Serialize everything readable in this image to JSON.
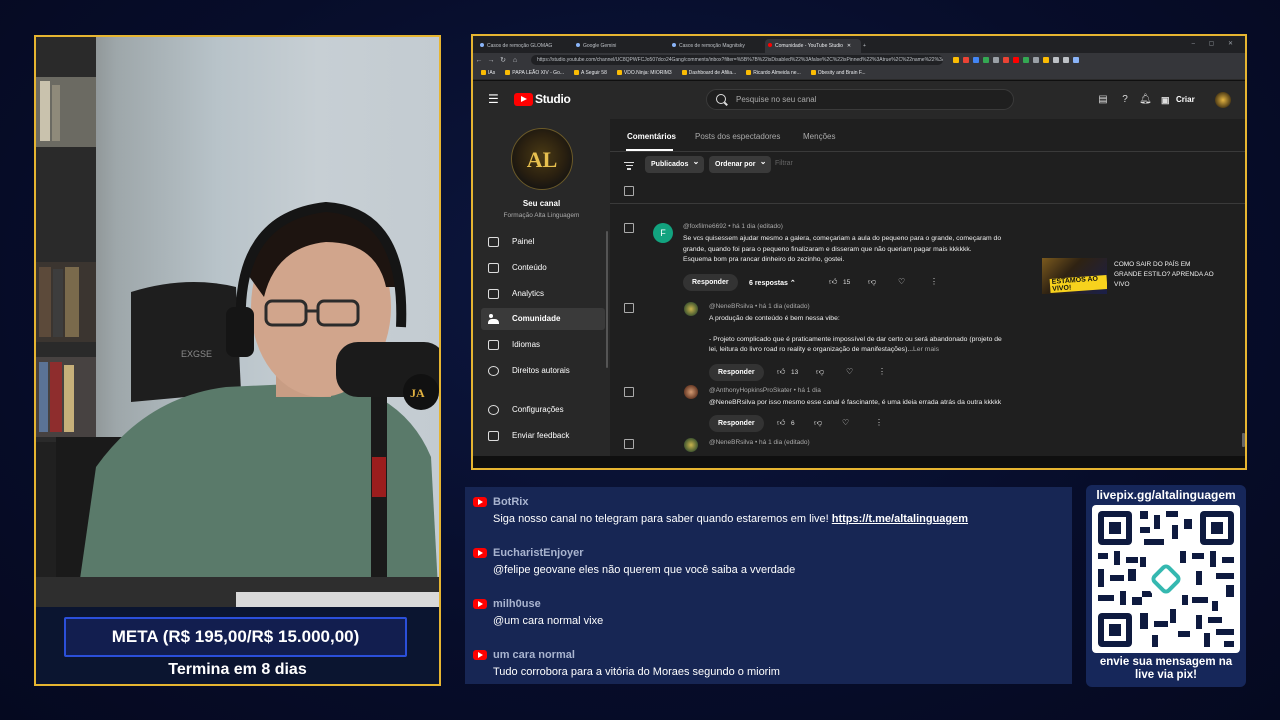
{
  "browser": {
    "tabs": [
      {
        "label": "Casos de remoção GLOMAG",
        "active": false
      },
      {
        "label": "Google Gemini",
        "active": false
      },
      {
        "label": "Casos de remoção Magnitsky",
        "active": false
      },
      {
        "label": "Comunidade - YouTube Studio",
        "active": true
      }
    ],
    "url": "https://studio.youtube.com/channel/UC8QPWFCJo507dco24Gang/comments/inbox?filter=%5B%7B%22isDisabled%22%3Afalse%2C%22isPinned%22%3Atrue%2C%22name%22%3A...",
    "bookmarks": [
      "IAs",
      "PAPA LEÃO XIV - Go...",
      "A Seguir 58",
      "VDO.Ninja: MIORIM3",
      "Dashboard de Afilia...",
      "Ricardo Almeida ne...",
      "Obesity and Brain F..."
    ]
  },
  "studio": {
    "logo_text": "Studio",
    "search_placeholder": "Pesquise no seu canal",
    "create_label": "Criar",
    "channel": {
      "avatar_text": "AL",
      "title": "Seu canal",
      "subtitle": "Formação Alta Linguagem"
    },
    "sidebar": [
      {
        "label": "Painel",
        "icon": "dashboard-icon",
        "active": false
      },
      {
        "label": "Conteúdo",
        "icon": "content-icon",
        "active": false
      },
      {
        "label": "Analytics",
        "icon": "analytics-icon",
        "active": false
      },
      {
        "label": "Comunidade",
        "icon": "community-icon",
        "active": true
      },
      {
        "label": "Idiomas",
        "icon": "languages-icon",
        "active": false
      },
      {
        "label": "Direitos autorais",
        "icon": "copyright-icon",
        "active": false
      },
      {
        "label": "Configurações",
        "icon": "settings-icon",
        "active": false
      },
      {
        "label": "Enviar feedback",
        "icon": "feedback-icon",
        "active": false
      }
    ],
    "tabs": [
      "Comentários",
      "Posts dos espectadores",
      "Menções"
    ],
    "filters": {
      "published": "Publicados",
      "order": "Ordenar por",
      "filter_placeholder": "Filtrar"
    },
    "comments": [
      {
        "avatar_letter": "F",
        "avatar_color": "#12a37f",
        "author": "@foxfilme6692 • há 1 dia (editado)",
        "text_lines": [
          "Se vcs quisessem ajudar mesmo a galera, começariam a aula do pequeno para o grande, começaram do",
          "grande, quando foi para o pequeno finalizaram e disseram que não queriam pagar mais kkkkkk.",
          "Esquema bom pra rancar dinheiro do zezinho, gostei."
        ],
        "reply_label": "Responder",
        "replies_label": "6 respostas",
        "likes": "15"
      },
      {
        "author": "@NeneBRsilva • há 1 dia (editado)",
        "line1": "A produção de conteúdo é bem nessa vibe:",
        "line2": "- Projeto complicado que é praticamente impossível de dar certo ou será abandonado (projeto de",
        "line3": "lei, leitura do livro road ro reality e organização de manifestações)...",
        "read_more": "Ler mais",
        "reply_label": "Responder",
        "likes": "13"
      },
      {
        "author": "@AnthonyHopkinsProSkater • há 1 dia",
        "text": "@NeneBRsilva por isso mesmo esse canal é fascinante, é uma ideia errada atrás da outra kkkkk",
        "reply_label": "Responder",
        "likes": "6"
      },
      {
        "author": "@NeneBRsilva • há 1 dia (editado)"
      }
    ],
    "video": {
      "thumb_text": "ESTAMOS AO VIVO!",
      "title": "COMO SAIR DO PAÍS EM GRANDE ESTILO? APRENDA AO VIVO"
    }
  },
  "stream": {
    "goal": "META (R$ 195,00/R$ 15.000,00)",
    "ends": "Termina em 8 dias",
    "pix_url": "livepix.gg/altalinguagem",
    "pix_caption_1": "envie sua mensagem na",
    "pix_caption_2": "live via pix!"
  },
  "chat": [
    {
      "user": "BotRix",
      "text": "Siga nosso canal no telegram para saber quando estaremos em live! ",
      "link": "https://t.me/altalinguagem"
    },
    {
      "user": "EucharistEnjoyer",
      "text": "@felipe geovane eles não querem que você saiba a vverdade"
    },
    {
      "user": "milh0use",
      "text": "@um cara normal vixe"
    },
    {
      "user": "um cara normal",
      "text": "Tudo corrobora para a vitória do Moraes segundo o miorim"
    }
  ]
}
